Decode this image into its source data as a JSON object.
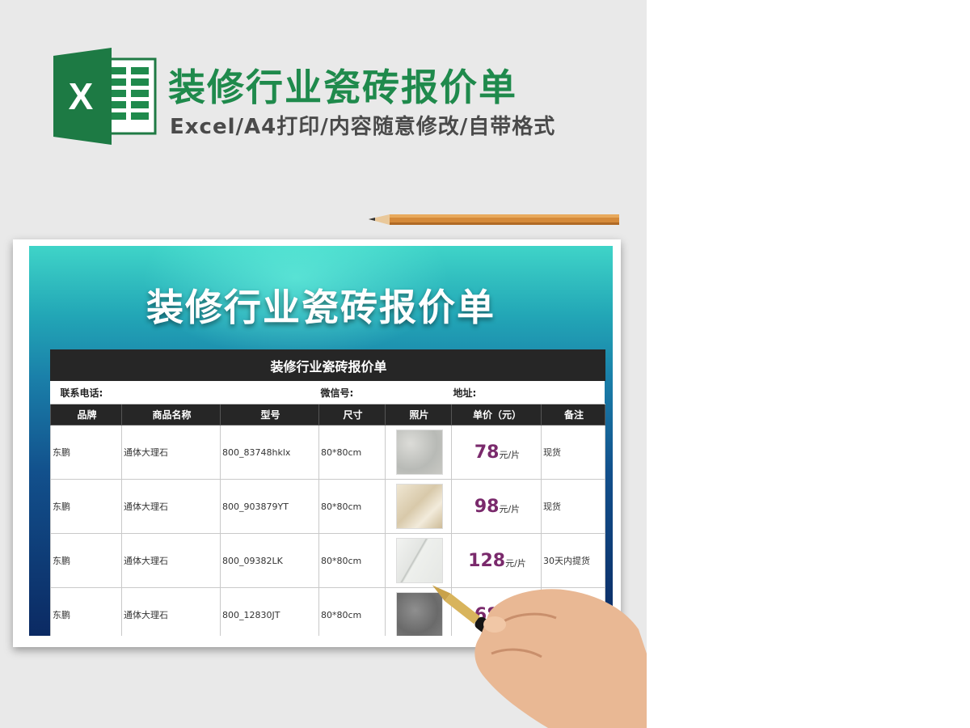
{
  "header": {
    "title": "装修行业瓷砖报价单",
    "subtitle": "Excel/A4打印/内容随意修改/自带格式",
    "logo_letter": "X"
  },
  "sheet": {
    "banner_title": "装修行业瓷砖报价单",
    "table_title": "装修行业瓷砖报价单",
    "info": {
      "phone_label": "联系电话:",
      "wechat_label": "微信号:",
      "address_label": "地址:"
    },
    "columns": [
      "品牌",
      "商品名称",
      "型号",
      "尺寸",
      "照片",
      "单价（元）",
      "备注"
    ],
    "price_unit": "元/片",
    "rows": [
      {
        "brand": "东鹏",
        "name": "通体大理石",
        "model": "800_83748hklx",
        "size": "80*80cm",
        "price": "78",
        "note": "现货",
        "photo": "light-gray-marble"
      },
      {
        "brand": "东鹏",
        "name": "通体大理石",
        "model": "800_903879YT",
        "size": "80*80cm",
        "price": "98",
        "note": "现货",
        "photo": "beige-marble"
      },
      {
        "brand": "东鹏",
        "name": "通体大理石",
        "model": "800_09382LK",
        "size": "80*80cm",
        "price": "128",
        "note": "30天内提货",
        "photo": "white-veined-marble"
      },
      {
        "brand": "东鹏",
        "name": "通体大理石",
        "model": "800_12830JT",
        "size": "80*80cm",
        "price": "68",
        "note": "",
        "photo": "dark-gray-stone"
      }
    ]
  },
  "colors": {
    "brand_green": "#1f8a4c",
    "price_purple": "#7a2a6c",
    "header_black": "#262626"
  },
  "icons": [
    "excel-logo-icon",
    "pencil-icon",
    "hand-with-pen-icon"
  ]
}
